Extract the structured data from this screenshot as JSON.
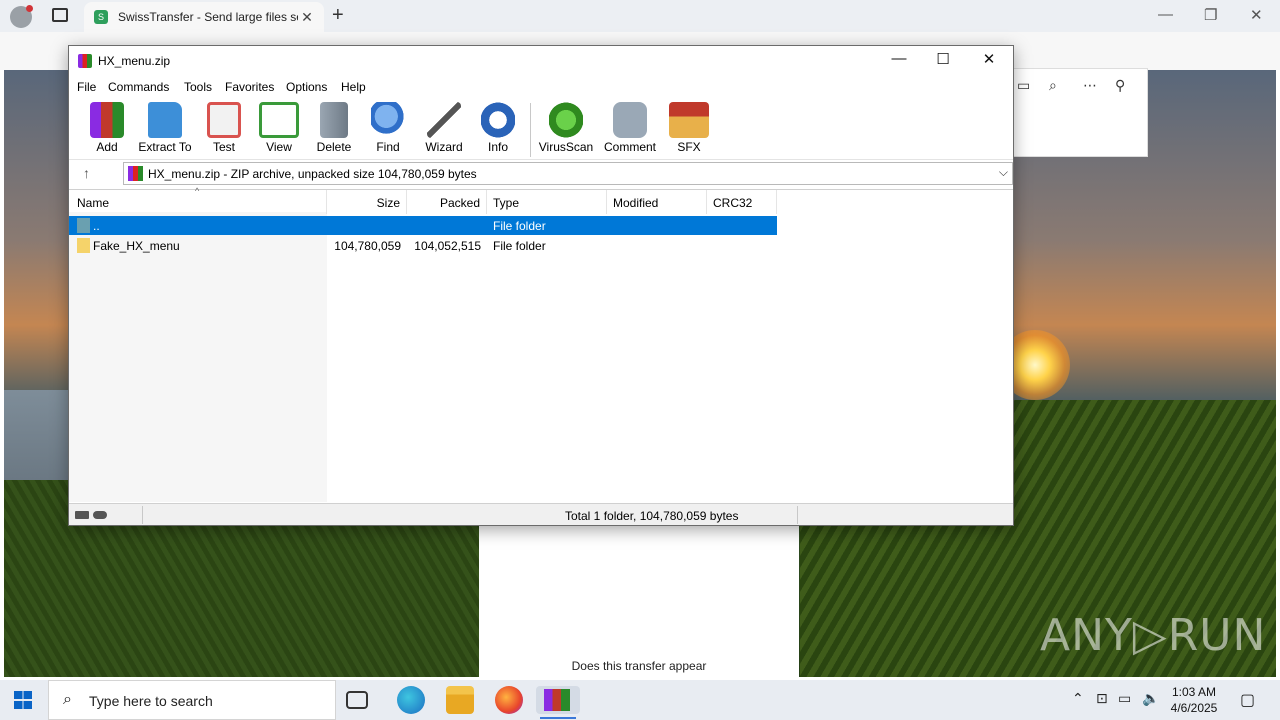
{
  "browser": {
    "tab_title": "SwissTransfer - Send large files se",
    "tab_favicon_color": "#2e9f5c"
  },
  "webpage": {
    "card_text": "Does this transfer appear"
  },
  "watermark": "ANY▷RUN",
  "winrar": {
    "title": "HX_menu.zip",
    "menu": [
      "File",
      "Commands",
      "Tools",
      "Favorites",
      "Options",
      "Help"
    ],
    "toolbar": [
      {
        "label": "Add",
        "icon": "add-archive-icon",
        "color": "#c0392b"
      },
      {
        "label": "Extract To",
        "icon": "extract-folder-icon",
        "color": "#3d8fd8"
      },
      {
        "label": "Test",
        "icon": "test-clipboard-icon",
        "color": "#d9534f"
      },
      {
        "label": "View",
        "icon": "view-book-icon",
        "color": "#3a9a3a"
      },
      {
        "label": "Delete",
        "icon": "delete-trash-icon",
        "color": "#8a96a3"
      },
      {
        "label": "Find",
        "icon": "find-magnifier-icon",
        "color": "#2f6fc9"
      },
      {
        "label": "Wizard",
        "icon": "wizard-wand-icon",
        "color": "#6a6a6a"
      },
      {
        "label": "Info",
        "icon": "info-icon",
        "color": "#2a63b8"
      },
      {
        "label": "VirusScan",
        "icon": "virusscan-icon",
        "color": "#3aa02a"
      },
      {
        "label": "Comment",
        "icon": "comment-icon",
        "color": "#7d8b99"
      },
      {
        "label": "SFX",
        "icon": "sfx-box-icon",
        "color": "#d98a2b"
      }
    ],
    "address": "HX_menu.zip - ZIP archive, unpacked size 104,780,059 bytes",
    "columns": [
      "Name",
      "Size",
      "Packed",
      "Type",
      "Modified",
      "CRC32"
    ],
    "rows": [
      {
        "name": "..",
        "size": "",
        "packed": "",
        "type": "File folder",
        "selected": true
      },
      {
        "name": "Fake_HX_menu",
        "size": "104,780,059",
        "packed": "104,052,515",
        "type": "File folder",
        "selected": false
      }
    ],
    "status": "Total 1 folder, 104,780,059 bytes"
  },
  "taskbar": {
    "search_placeholder": "Type here to search",
    "time": "1:03 AM",
    "date": "4/6/2025"
  }
}
